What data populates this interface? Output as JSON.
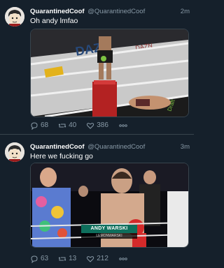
{
  "tweets": [
    {
      "display_name": "QuarantinedCoof",
      "handle": "@QuarantinedCoof",
      "time": "2m",
      "text": "Oh andy lmfao",
      "replies": "68",
      "retweets": "40",
      "likes": "386"
    },
    {
      "display_name": "QuarantinedCoof",
      "handle": "@QuarantinedCoof",
      "time": "3m",
      "text": "Here we fucking go",
      "replies": "63",
      "retweets": "13",
      "likes": "212",
      "media_caption": {
        "name": "ANDY WARSKI",
        "sub": "LEMONWARSKI"
      }
    }
  ],
  "icons": [
    "reply-icon",
    "retweet-icon",
    "like-icon",
    "more-icon"
  ],
  "colors": {
    "background": "#15202b",
    "secondary_text": "#8899a6",
    "divider": "#38444d"
  }
}
